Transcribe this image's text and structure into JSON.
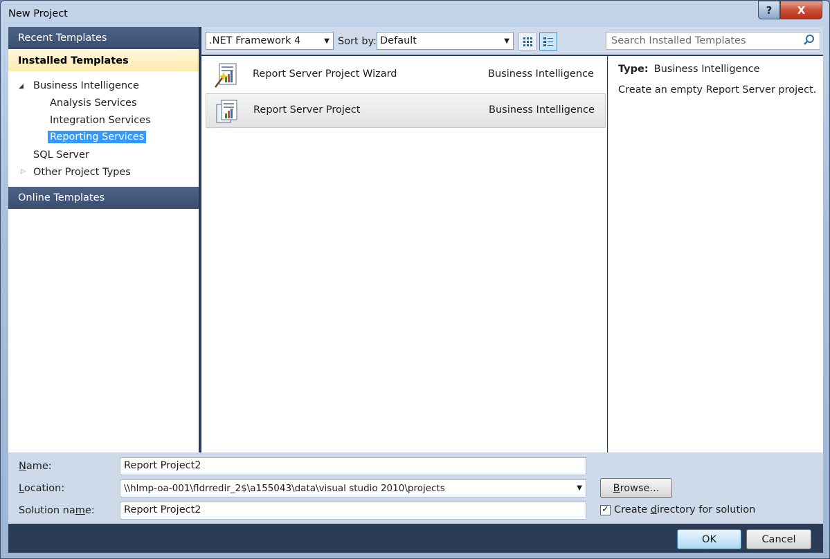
{
  "window": {
    "title": "New Project",
    "help_icon": "?",
    "close_icon": "X"
  },
  "left": {
    "recent_header": "Recent Templates",
    "installed_header": "Installed Templates",
    "online_header": "Online Templates",
    "tree": {
      "bi": "Business Intelligence",
      "analysis": "Analysis Services",
      "integration": "Integration Services",
      "reporting": "Reporting Services",
      "sql": "SQL Server",
      "other": "Other Project Types"
    }
  },
  "toolbar": {
    "framework": ".NET Framework 4",
    "sort_label": "Sort by:",
    "sort_value": "Default",
    "search_placeholder": "Search Installed Templates"
  },
  "templates": [
    {
      "name": "Report Server Project Wizard",
      "category": "Business Intelligence",
      "icon": "report-wizard-icon"
    },
    {
      "name": "Report Server Project",
      "category": "Business Intelligence",
      "icon": "report-project-icon"
    }
  ],
  "details": {
    "type_label": "Type:",
    "type_value": "Business Intelligence",
    "description": "Create an empty Report Server project."
  },
  "form": {
    "name_label_u": "N",
    "name_label_rest": "ame:",
    "name_value": "Report Project2",
    "location_label_u": "L",
    "location_label_rest": "ocation:",
    "location_value": "\\\\hlmp-oa-001\\fldrredir_2$\\a155043\\data\\visual studio 2010\\projects",
    "solution_label_a": "Solution na",
    "solution_label_u": "m",
    "solution_label_b": "e:",
    "solution_value": "Report Project2",
    "browse_u": "B",
    "browse_rest": "rowse...",
    "create_dir_a": "Create ",
    "create_dir_u": "d",
    "create_dir_b": "irectory for solution",
    "create_dir_checked": true
  },
  "buttons": {
    "ok": "OK",
    "cancel": "Cancel"
  }
}
